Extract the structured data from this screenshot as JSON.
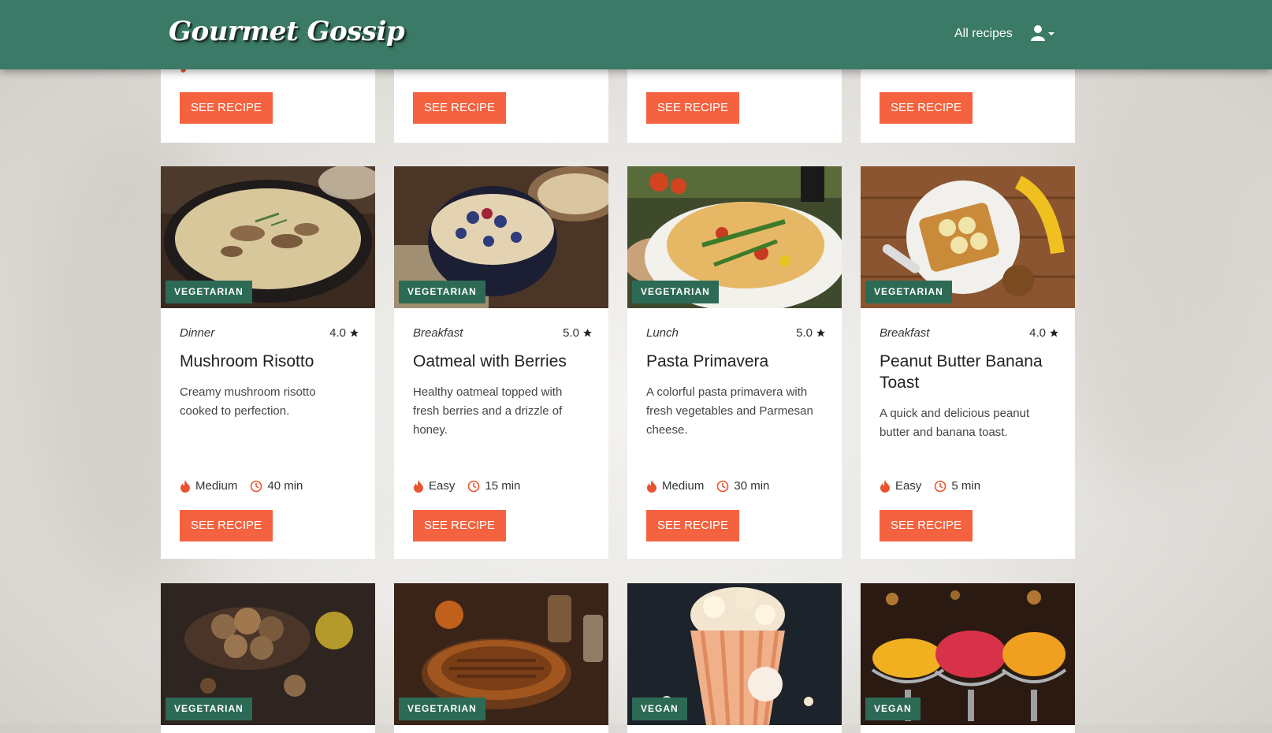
{
  "header": {
    "logo": "Gourmet Gossip",
    "nav_all_recipes": "All recipes"
  },
  "colors": {
    "header_bg": "#3a7a66",
    "badge_bg": "#2d6a56",
    "button_bg": "#f5623f",
    "icon_accent": "#e8542f"
  },
  "top_row": {
    "cards": [
      {
        "button": "SEE RECIPE"
      },
      {
        "button": "SEE RECIPE"
      },
      {
        "button": "SEE RECIPE"
      },
      {
        "button": "SEE RECIPE"
      }
    ]
  },
  "middle_row": {
    "cards": [
      {
        "badge": "VEGETARIAN",
        "category": "Dinner",
        "rating": "4.0",
        "title": "Mushroom Risotto",
        "description": "Creamy mushroom risotto cooked to perfection.",
        "difficulty": "Medium",
        "time": "40 min",
        "button": "SEE RECIPE",
        "image_icon": "mushroom-risotto-photo"
      },
      {
        "badge": "VEGETARIAN",
        "category": "Breakfast",
        "rating": "5.0",
        "title": "Oatmeal with Berries",
        "description": "Healthy oatmeal topped with fresh berries and a drizzle of honey.",
        "difficulty": "Easy",
        "time": "15 min",
        "button": "SEE RECIPE",
        "image_icon": "oatmeal-berries-photo"
      },
      {
        "badge": "VEGETARIAN",
        "category": "Lunch",
        "rating": "5.0",
        "title": "Pasta Primavera",
        "description": "A colorful pasta primavera with fresh vegetables and Parmesan cheese.",
        "difficulty": "Medium",
        "time": "30 min",
        "button": "SEE RECIPE",
        "image_icon": "pasta-primavera-photo"
      },
      {
        "badge": "VEGETARIAN",
        "category": "Breakfast",
        "rating": "4.0",
        "title": "Peanut Butter Banana Toast",
        "description": "A quick and delicious peanut butter and banana toast.",
        "difficulty": "Easy",
        "time": "5 min",
        "button": "SEE RECIPE",
        "image_icon": "peanut-butter-toast-photo"
      }
    ]
  },
  "bottom_row": {
    "cards": [
      {
        "badge": "VEGETARIAN",
        "image_icon": "energy-balls-photo"
      },
      {
        "badge": "VEGETARIAN",
        "image_icon": "pecan-pie-photo"
      },
      {
        "badge": "VEGAN",
        "image_icon": "popcorn-photo"
      },
      {
        "badge": "VEGAN",
        "image_icon": "sorbet-cups-photo"
      }
    ]
  }
}
